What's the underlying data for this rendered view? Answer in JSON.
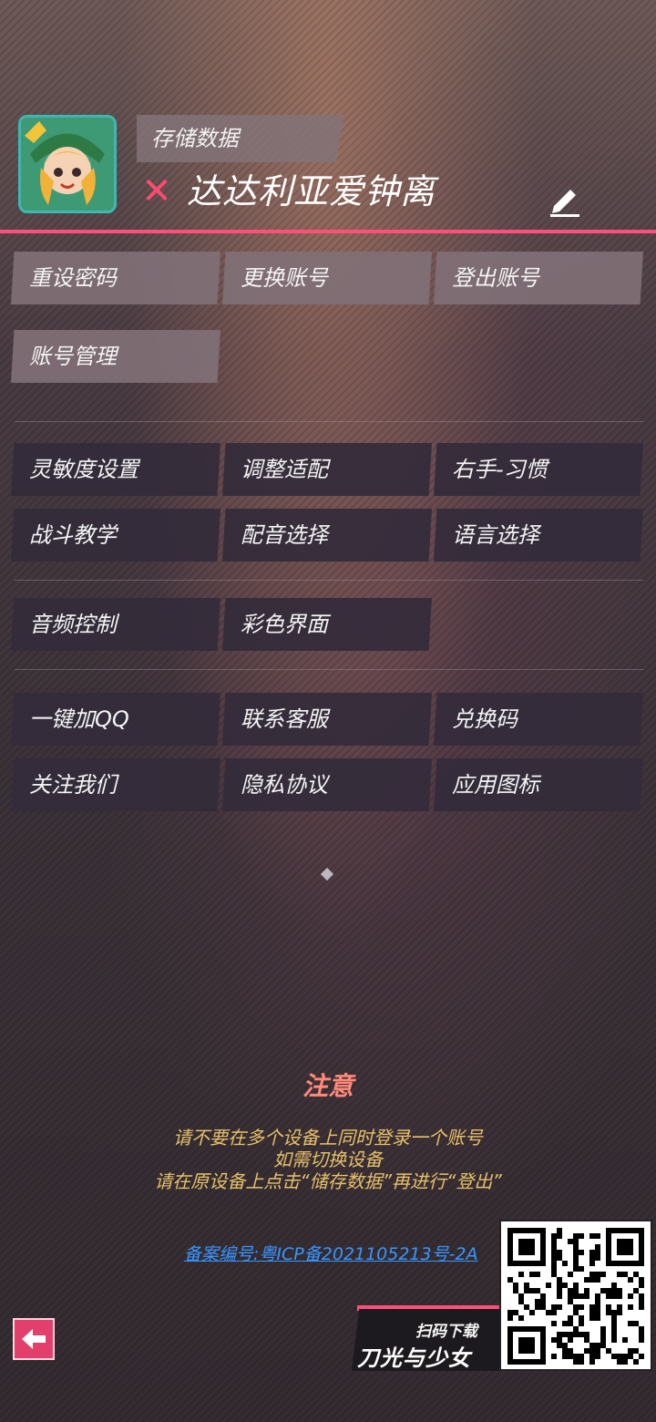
{
  "profile": {
    "save_label": "存储数据",
    "status_icon": "x-mark-icon",
    "username": "达达利亚爱钟离",
    "edit_icon": "pencil-icon"
  },
  "account_buttons": [
    {
      "label": "重设密码"
    },
    {
      "label": "更换账号"
    },
    {
      "label": "登出账号"
    },
    {
      "label": "账号管理"
    }
  ],
  "settings_buttons": [
    {
      "label": "灵敏度设置"
    },
    {
      "label": "调整适配"
    },
    {
      "label": "右手-习惯"
    },
    {
      "label": "战斗教学"
    },
    {
      "label": "配音选择"
    },
    {
      "label": "语言选择"
    }
  ],
  "media_buttons": [
    {
      "label": "音频控制"
    },
    {
      "label": "彩色界面"
    }
  ],
  "service_buttons": [
    {
      "label": "一键加QQ"
    },
    {
      "label": "联系客服"
    },
    {
      "label": "兑换码"
    },
    {
      "label": "关注我们"
    },
    {
      "label": "隐私协议"
    },
    {
      "label": "应用图标"
    }
  ],
  "notice": {
    "title": "注意",
    "lines": [
      "请不要在多个设备上同时登录一个账号",
      "如需切换设备",
      "请在原设备上点击“储存数据”再进行“登出”"
    ]
  },
  "footer": {
    "icp_text": "备案编号:粤ICP备2021105213号-2A",
    "download_label": "扫码下载",
    "brand_name": "刀光与少女",
    "back_icon": "left-arrow-icon"
  },
  "colors": {
    "accent_pink": "#ff4f7b",
    "notice_title": "#ff8a7a",
    "notice_text": "#e7c16a",
    "link_blue": "#3a95ff"
  }
}
